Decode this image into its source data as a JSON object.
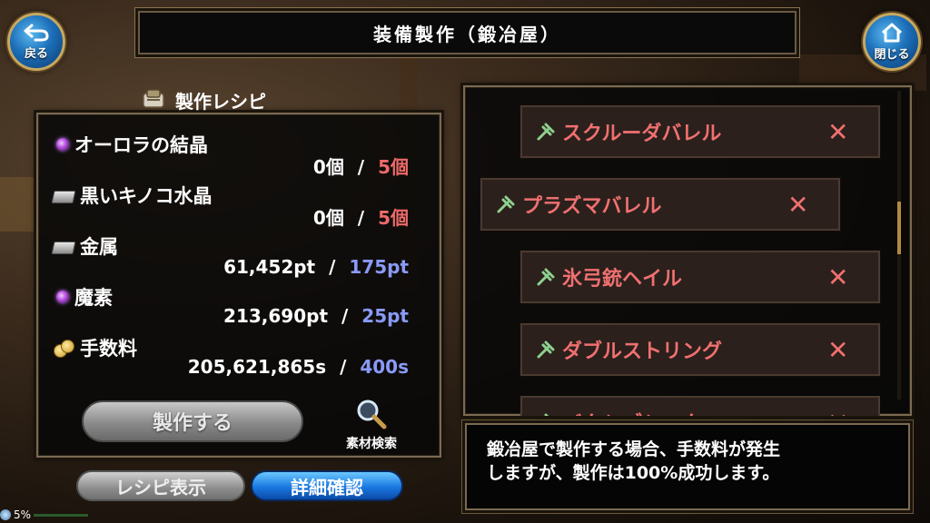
{
  "nav": {
    "back_label": "戻る",
    "close_label": "閉じる"
  },
  "title": "装備製作（鍛冶屋）",
  "recipe": {
    "header": "製作レシピ",
    "materials": [
      {
        "name": "オーロラの結晶",
        "icon": "purple-orb-icon",
        "have": "0個",
        "sep": "/",
        "need": "5個",
        "need_color": "#f06a6a"
      },
      {
        "name": "黒いキノコ水晶",
        "icon": "ingot-icon",
        "have": "0個",
        "sep": "/",
        "need": "5個",
        "need_color": "#f06a6a"
      },
      {
        "name": "金属",
        "icon": "ingot-icon",
        "have": "61,452pt",
        "sep": "/",
        "need": "175pt",
        "need_color": "#8a9af8"
      },
      {
        "name": "魔素",
        "icon": "purple-orb-icon",
        "have": "213,690pt",
        "sep": "/",
        "need": "25pt",
        "need_color": "#8a9af8"
      },
      {
        "name": "手数料",
        "icon": "coins-icon",
        "have": "205,621,865s",
        "sep": "/",
        "need": "400s",
        "need_color": "#8a9af8"
      }
    ],
    "craft_label": "製作する",
    "search_label": "素材検索"
  },
  "tabs": {
    "recipe_label": "レシピ表示",
    "detail_label": "詳細確認"
  },
  "list": {
    "items": [
      {
        "name": "スクルーダバレル",
        "remove": "✕"
      },
      {
        "name": "プラズマバレル",
        "remove": "✕"
      },
      {
        "name": "氷弓銃ヘイル",
        "remove": "✕"
      },
      {
        "name": "ダブルストリング",
        "remove": "✕"
      },
      {
        "name": "バタシブシ　タ",
        "remove": "✕"
      }
    ]
  },
  "description": {
    "line1": "鍛冶屋で製作する場合、手数料が発生",
    "line2": "しますが、製作は100%成功します。"
  },
  "status": {
    "battery": "5%"
  },
  "colors": {
    "item_text": "#f07070",
    "accent_blue": "#1a78e0",
    "frame_gold": "#c8a860"
  }
}
